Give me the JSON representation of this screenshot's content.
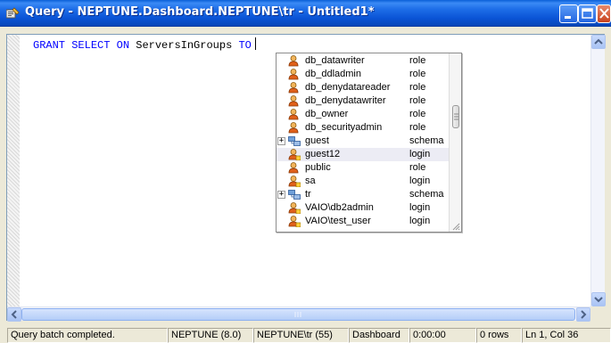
{
  "window": {
    "title": "Query - NEPTUNE.Dashboard.NEPTUNE\\tr - Untitled1*",
    "titlebar_color": "#0a54d6"
  },
  "editor": {
    "keywords": [
      "GRANT",
      "SELECT",
      "ON"
    ],
    "object_name": "ServersInGroups",
    "keyword_to": "TO",
    "keyword_color": "#0000ff"
  },
  "autocomplete": {
    "items": [
      {
        "name": "db_datawriter",
        "type": "role",
        "icon": "role-user-icon",
        "expandable": false,
        "selected": false
      },
      {
        "name": "db_ddladmin",
        "type": "role",
        "icon": "role-user-icon",
        "expandable": false,
        "selected": false
      },
      {
        "name": "db_denydatareader",
        "type": "role",
        "icon": "role-user-icon",
        "expandable": false,
        "selected": false
      },
      {
        "name": "db_denydatawriter",
        "type": "role",
        "icon": "role-user-icon",
        "expandable": false,
        "selected": false
      },
      {
        "name": "db_owner",
        "type": "role",
        "icon": "role-user-icon",
        "expandable": false,
        "selected": false
      },
      {
        "name": "db_securityadmin",
        "type": "role",
        "icon": "role-user-icon",
        "expandable": false,
        "selected": false
      },
      {
        "name": "guest",
        "type": "schema",
        "icon": "schema-icon",
        "expandable": true,
        "selected": false
      },
      {
        "name": "guest12",
        "type": "login",
        "icon": "login-user-icon",
        "expandable": false,
        "selected": true
      },
      {
        "name": "public",
        "type": "role",
        "icon": "role-user-icon",
        "expandable": false,
        "selected": false
      },
      {
        "name": "sa",
        "type": "login",
        "icon": "login-user-icon",
        "expandable": false,
        "selected": false
      },
      {
        "name": "tr",
        "type": "schema",
        "icon": "schema-icon",
        "expandable": true,
        "selected": false
      },
      {
        "name": "VAIO\\db2admin",
        "type": "login",
        "icon": "login-user-icon",
        "expandable": false,
        "selected": false
      },
      {
        "name": "VAIO\\test_user",
        "type": "login",
        "icon": "login-user-icon",
        "expandable": false,
        "selected": false
      }
    ],
    "expander_glyph": "+"
  },
  "statusbar": {
    "message": "Query batch completed.",
    "server": "NEPTUNE (8.0)",
    "user": "NEPTUNE\\tr (55)",
    "database": "Dashboard",
    "elapsed": "0:00:00",
    "rows": "0 rows",
    "position": "Ln 1, Col 36"
  }
}
